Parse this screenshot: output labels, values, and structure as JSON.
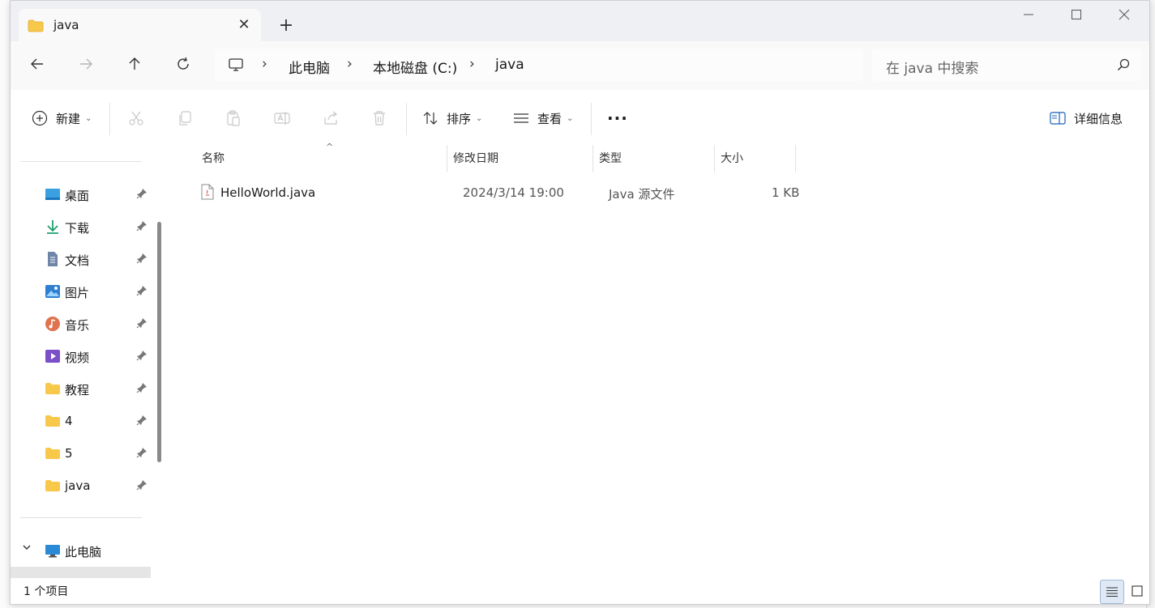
{
  "tab": {
    "title": "java"
  },
  "address": {
    "crumbs": [
      "此电脑",
      "本地磁盘 (C:)",
      "java"
    ]
  },
  "search": {
    "placeholder": "在 java 中搜索"
  },
  "toolbar": {
    "new_label": "新建",
    "sort_label": "排序",
    "view_label": "查看",
    "details_label": "详细信息"
  },
  "nav": {
    "items": [
      {
        "label": "桌面",
        "icon": "desktop-icon"
      },
      {
        "label": "下载",
        "icon": "download-icon"
      },
      {
        "label": "文档",
        "icon": "document-icon"
      },
      {
        "label": "图片",
        "icon": "picture-icon"
      },
      {
        "label": "音乐",
        "icon": "music-icon"
      },
      {
        "label": "视频",
        "icon": "video-icon"
      },
      {
        "label": "教程",
        "icon": "folder-icon"
      },
      {
        "label": "4",
        "icon": "folder-icon"
      },
      {
        "label": "5",
        "icon": "folder-icon"
      },
      {
        "label": "java",
        "icon": "folder-icon"
      }
    ],
    "this_pc_label": "此电脑"
  },
  "columns": {
    "name": "名称",
    "date": "修改日期",
    "type": "类型",
    "size": "大小"
  },
  "files": [
    {
      "name": "HelloWorld.java",
      "date": "2024/3/14 19:00",
      "type": "Java 源文件",
      "size": "1 KB"
    }
  ],
  "status": {
    "count": "1 个项目"
  },
  "colors": {
    "accent": "#0067c0",
    "folder": "#f8c84a",
    "titlebar": "#eef0f4"
  }
}
